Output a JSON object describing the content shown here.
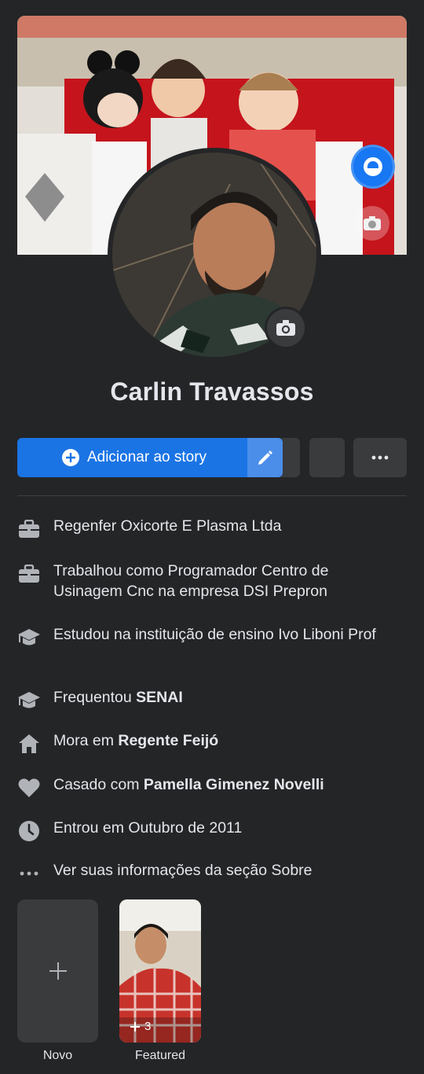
{
  "profile": {
    "name": "Carlin Travassos"
  },
  "actions": {
    "add_story_label": "Adicionar ao story"
  },
  "info": [
    {
      "icon": "briefcase-icon",
      "text": "Regenfer Oxicorte E Plasma Ltda",
      "bold": ""
    },
    {
      "icon": "briefcase-icon",
      "text": "Trabalhou como Programador Centro de Usinagem Cnc na empresa DSI Prepron",
      "bold": ""
    },
    {
      "icon": "graduation-cap-icon",
      "text": "Estudou na instituição de ensino Ivo Liboni Prof",
      "bold": ""
    },
    {
      "icon": "graduation-cap-icon",
      "text": "Frequentou ",
      "bold": "SENAI"
    },
    {
      "icon": "home-icon",
      "text": "Mora em ",
      "bold": "Regente Feijó"
    },
    {
      "icon": "heart-icon",
      "text": "Casado com ",
      "bold": "Pamella Gimenez Novelli"
    },
    {
      "icon": "clock-icon",
      "text": "Entrou em Outubro de 2011",
      "bold": ""
    },
    {
      "icon": "more-dots-icon",
      "text": "Ver suas informações da seção Sobre",
      "bold": ""
    }
  ],
  "featured": {
    "new_label": "Novo",
    "collection_label": "Featured",
    "collection_count": "3"
  },
  "colors": {
    "background": "#242527",
    "primary": "#1b74e4",
    "surface": "#3a3b3c"
  }
}
